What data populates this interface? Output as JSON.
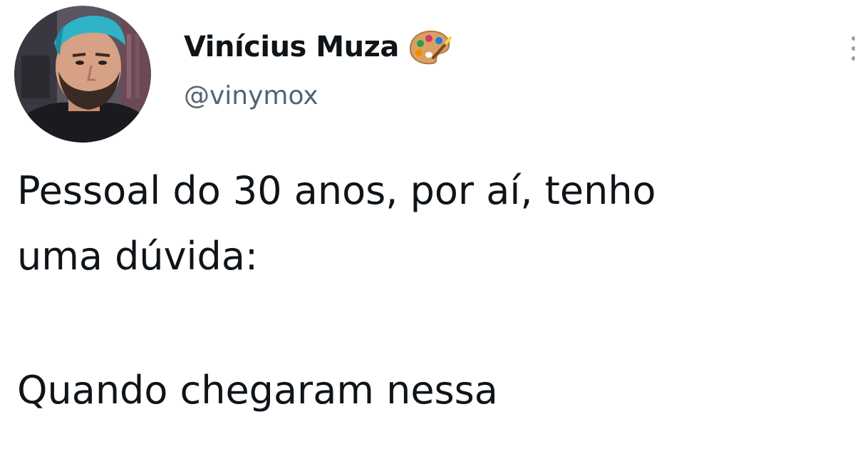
{
  "tweet": {
    "author": {
      "display_name": "Vinícius Muza",
      "handle": "@vinymox",
      "badge_icon": "artist-palette-icon",
      "avatar_icon": "avatar-photo"
    },
    "text_lines": [
      "Pessoal do 30 anos, por aí, tenho",
      "uma dúvida:",
      "",
      "Quando chegaram nessa"
    ]
  },
  "colors": {
    "text": "#0f1419",
    "handle": "#536471",
    "background": "#ffffff",
    "avatar_hair": "#2fb3c6"
  }
}
